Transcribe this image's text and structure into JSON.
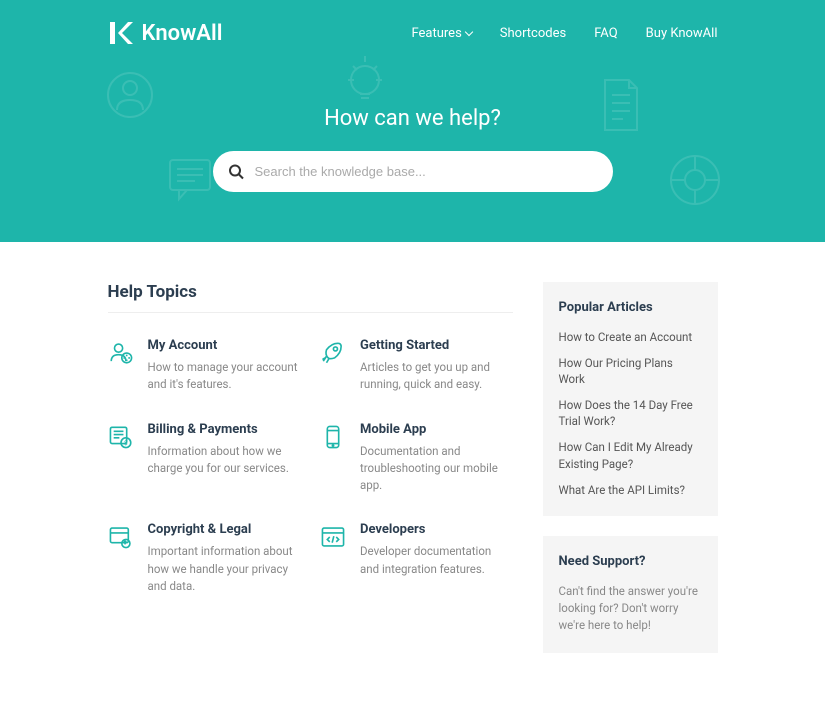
{
  "brand": "KnowAll",
  "nav": {
    "features": "Features",
    "shortcodes": "Shortcodes",
    "faq": "FAQ",
    "buy": "Buy KnowAll"
  },
  "hero": {
    "title": "How can we help?",
    "search_placeholder": "Search the knowledge base..."
  },
  "topics_heading": "Help Topics",
  "topics": [
    {
      "title": "My Account",
      "desc": "How to manage your account and it's features."
    },
    {
      "title": "Getting Started",
      "desc": "Articles to get you up and running, quick and easy."
    },
    {
      "title": "Billing & Payments",
      "desc": "Information about how we charge you for our services."
    },
    {
      "title": "Mobile App",
      "desc": "Documentation and troubleshooting our mobile app."
    },
    {
      "title": "Copyright & Legal",
      "desc": "Important information about how we handle your privacy and data."
    },
    {
      "title": "Developers",
      "desc": "Developer documentation and integration features."
    }
  ],
  "sidebar": {
    "popular_title": "Popular Articles",
    "popular": [
      "How to Create an Account",
      "How Our Pricing Plans Work",
      "How Does the 14 Day Free Trial Work?",
      "How Can I Edit My Already Existing Page?",
      "What Are the API Limits?"
    ],
    "support_title": "Need Support?",
    "support_text": "Can't find the answer you're looking for? Don't worry we're here to help!"
  },
  "colors": {
    "accent": "#1eb5aa"
  }
}
